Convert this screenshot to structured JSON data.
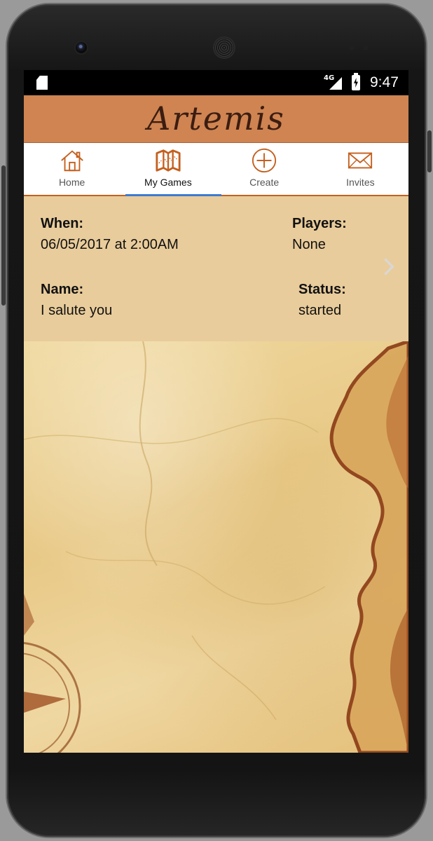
{
  "status_bar": {
    "network": "4G",
    "time": "9:47"
  },
  "app": {
    "title": "Artemis"
  },
  "tabs": [
    {
      "label": "Home",
      "icon": "home-icon",
      "active": false
    },
    {
      "label": "My Games",
      "icon": "map-icon",
      "active": true
    },
    {
      "label": "Create",
      "icon": "plus-circle-icon",
      "active": false
    },
    {
      "label": "Invites",
      "icon": "envelope-icon",
      "active": false
    }
  ],
  "game": {
    "when_label": "When:",
    "when_value": "06/05/2017 at 2:00AM",
    "players_label": "Players:",
    "players_value": "None",
    "name_label": "Name:",
    "name_value": "I salute you",
    "status_label": "Status:",
    "status_value": "started"
  },
  "colors": {
    "appbar": "#cf8451",
    "accent": "#c4601f",
    "tab_indicator": "#3c7bd1",
    "card_bg": "#e9cc9b"
  }
}
